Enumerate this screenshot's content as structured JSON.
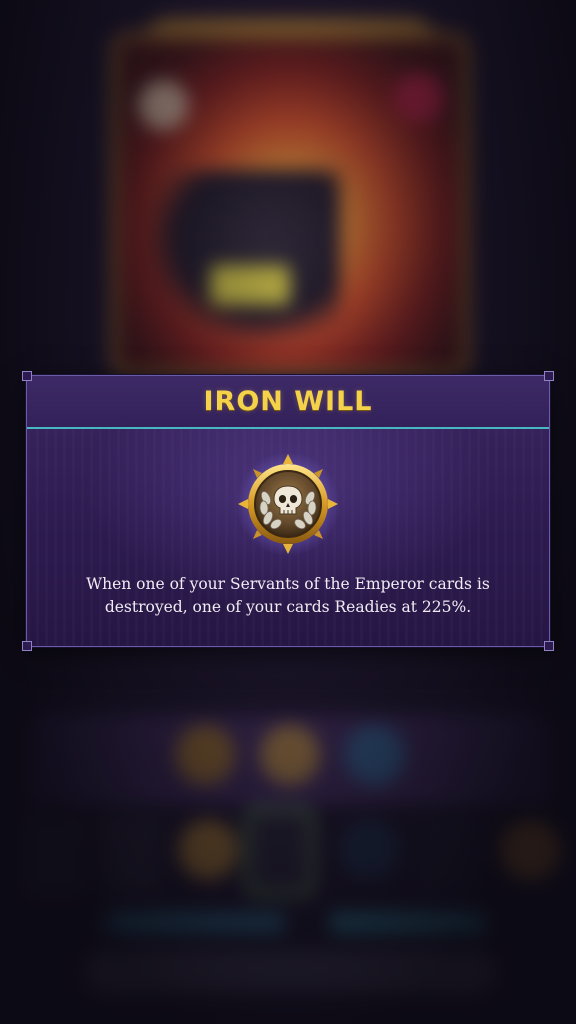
{
  "popup": {
    "title": "IRON WILL",
    "description": "When one of your Servants of the Emperor cards is destroyed, one of your cards Readies at 225%.",
    "icon": "laurel-skull-medal-icon"
  },
  "colors": {
    "title_gold": "#f4d24a",
    "divider_teal": "#47b8c3",
    "panel_purple": "#2d1b50"
  }
}
